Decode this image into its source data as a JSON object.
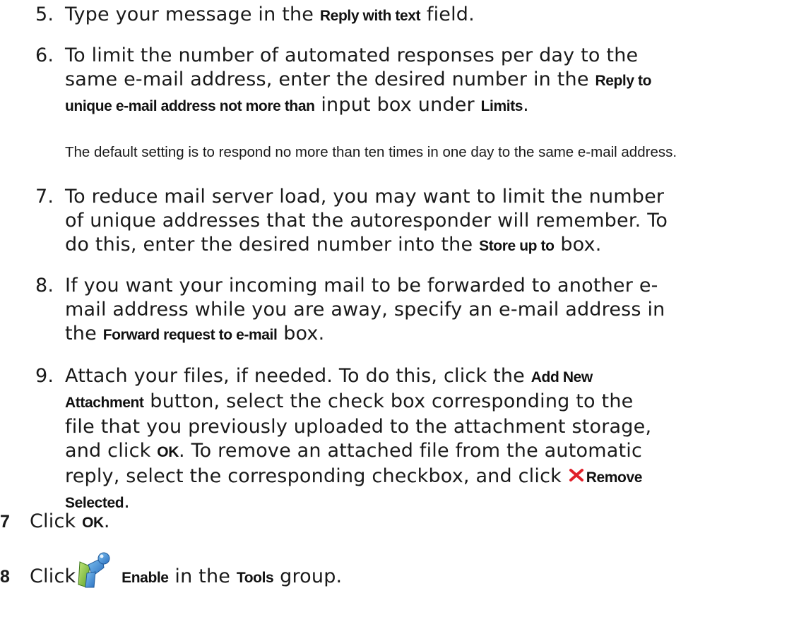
{
  "steps": [
    {
      "number": "5.",
      "line1": {
        "t1": "Type your message in the ",
        "b1": "Reply with text",
        "t2": " field."
      }
    },
    {
      "number": "6.",
      "line1": "To limit the number of automated responses per day to the",
      "line2": {
        "t1": "same e-mail address, enter the desired number in the ",
        "b1": "Reply to"
      },
      "line3": {
        "b1": "unique e-mail address not more than",
        "t1": " input box under ",
        "b2": "Limits",
        "t2": "."
      },
      "note": "The default setting is to respond no more than ten times in one day to the same e-mail address."
    },
    {
      "number": "7.",
      "line1": "To reduce mail server load, you may want to limit the number",
      "line2": "of unique addresses that the autoresponder will remember. To",
      "line3": {
        "t1": "do this, enter the desired number into the ",
        "b1": "Store up to",
        "t2": " box."
      }
    },
    {
      "number": "8.",
      "line1": "If you want your incoming mail to be forwarded to another e-",
      "line2": "mail address while you are away, specify an e-mail address in",
      "line3": {
        "t1": "the ",
        "b1": "Forward request to e-mail",
        "t2": "  box."
      }
    },
    {
      "number": "9.",
      "line1": {
        "t1": "Attach your files, if needed. To do this, click the  ",
        "b1": "Add New"
      },
      "line2": {
        "b1": "Attachment",
        "t1": " button, select the check box corresponding to the"
      },
      "line3": "file that you previously uploaded to the attachment storage,",
      "line4": {
        "t1": "and click ",
        "b1": "OK",
        "t2": ". To remove an attached file from the automatic"
      },
      "line5": {
        "t1": "reply, select the corresponding checkbox, and click ",
        "b1": "Remove"
      },
      "line6": {
        "b1": "Selected",
        "t1": "."
      }
    }
  ],
  "top_steps": [
    {
      "number": "7",
      "t1": "Click ",
      "b1": "OK",
      "t2": "."
    },
    {
      "number": "8",
      "t1": "Click ",
      "b1": "Enable",
      "t2": " in the ",
      "b2": "Tools",
      "t3": " group."
    }
  ],
  "icons": {
    "remove": "remove-x-icon",
    "enable": "enable-tool-icon"
  },
  "colors": {
    "remove_icon": "#e0202a",
    "enable_icon_blue": "#3a8fd8",
    "enable_icon_green": "#8ac43a"
  }
}
